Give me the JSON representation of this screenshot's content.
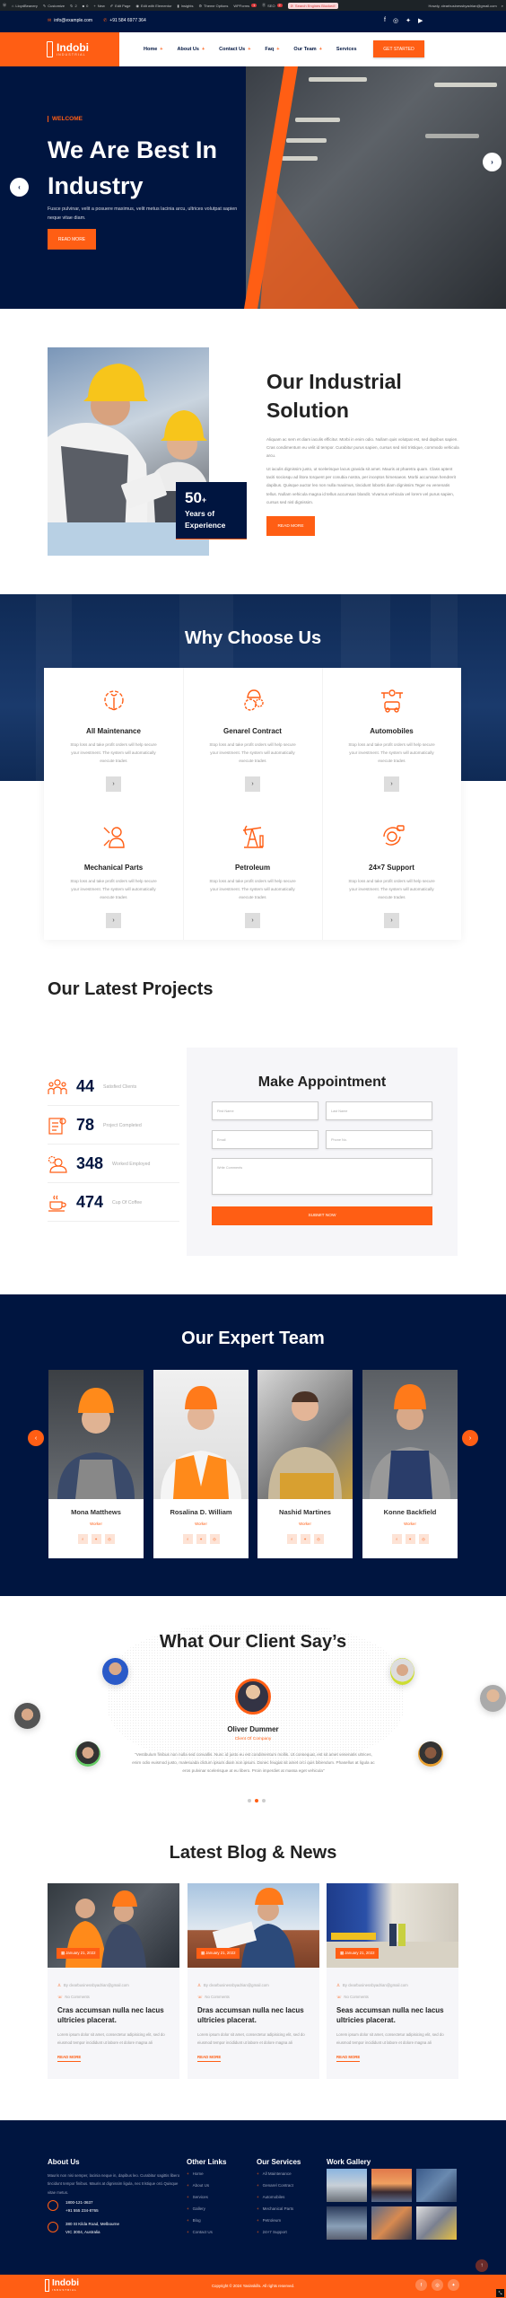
{
  "admin_bar": {
    "site": "LloydBeanery",
    "customize": "Customize",
    "updates": "2",
    "comments": "0",
    "new": "New",
    "edit_page": "Edit Page",
    "elementor": "Edit with Elementor",
    "insights": "Insights",
    "theme_options": "Theme Options",
    "wpforms": "WPForms",
    "wpforms_badge": "1",
    "seo": "SEO",
    "seo_badge": "2",
    "search_blocked": "Search Engines Blocked!",
    "howdy": "Howdy, clearbusinessbyadrian@gmail.com"
  },
  "topbar": {
    "email": "info@example.com",
    "phone": "+91 584 6977 364",
    "social_icons": [
      "facebook-icon",
      "instagram-icon",
      "twitter-icon",
      "youtube-icon"
    ]
  },
  "header": {
    "logo_name": "Indobi",
    "logo_sub": "INDUSTRIAL",
    "nav": [
      {
        "label": "Home",
        "has_sub": true
      },
      {
        "label": "About Us",
        "has_sub": true
      },
      {
        "label": "Contact Us",
        "has_sub": true
      },
      {
        "label": "Faq",
        "has_sub": true
      },
      {
        "label": "Our Team",
        "has_sub": true
      },
      {
        "label": "Services",
        "has_sub": false
      }
    ],
    "cta": "GET STARTED"
  },
  "hero": {
    "eyebrow": "WELCOME",
    "title": "We Are Best In Industry",
    "description": "Fusce pulvinar, velit a posuere maximus, velit metus lacinia arcu, ultrices volutpat sapien neque vitae diam.",
    "button": "READ MORE"
  },
  "solution": {
    "experience_number": "50",
    "experience_plus": "+",
    "experience_label": "Years of Experience",
    "title": "Our Industrial Solution",
    "paragraph1": "Aliquam ac sem et diam iaculis efficitur. Morbi in enim odio. Nullam quis volutpat est, sed dapibus sapien. Cras condimentum eu velit id tempor. Curabitur purus sapien, cursus sed nisl tristique, commodo vehicula arcu.",
    "paragraph2": "Ut iaculis dignissim justo, ut scelerisque lacus gravida sit amet. Mauris at pharetra quam. Class aptent taciti sociosqu ad litora torquent per conubia nostra, per inceptos himenaeos. Morbi accumsan hendrerit dapibus. Quisque auctor leo non nulla maximus, tincidunt lobortis diam dignissim.Teger eu venenatis tellus. Nullam vehicula magna id tellus accumsan blandit. Vivamus vehicula vel lorem vel purus sapien, cursus sed nisl dignissim.",
    "button": "READ MORE"
  },
  "why": {
    "title": "Why Choose Us",
    "features": [
      {
        "title": "All Maintenance",
        "icon": "gear-wrench-icon",
        "desc": "Stop loss and take profit orders will help secure your investment. The system will automatically execute trades"
      },
      {
        "title": "Genarel Contract",
        "icon": "helmet-gears-icon",
        "desc": "Stop loss and take profit orders will help secure your investment. The system will automatically execute trades"
      },
      {
        "title": "Automobiles",
        "icon": "car-circuit-icon",
        "desc": "Stop loss and take profit orders will help secure your investment. The system will automatically execute trades"
      },
      {
        "title": "Mechanical Parts",
        "icon": "mechanic-icon",
        "desc": "Stop loss and take profit orders will help secure your investment. The system will automatically execute trades"
      },
      {
        "title": "Petroleum",
        "icon": "oil-pump-icon",
        "desc": "Stop loss and take profit orders will help secure your investment. The system will automatically execute trades"
      },
      {
        "title": "24×7 Support",
        "icon": "support-agent-icon",
        "desc": "Stop loss and take profit orders will help secure your investment. The system will automatically execute trades"
      }
    ]
  },
  "projects": {
    "title": "Our Latest Projects",
    "stats": [
      {
        "value": "44",
        "label": "Satisfied Clients",
        "icon": "group-icon"
      },
      {
        "value": "78",
        "label": "Project Completed",
        "icon": "clipboard-check-icon"
      },
      {
        "value": "348",
        "label": "Worked Employed",
        "icon": "worker-icon"
      },
      {
        "value": "474",
        "label": "Cup Of Coffee",
        "icon": "coffee-cup-icon"
      }
    ]
  },
  "appointment": {
    "title": "Make Appointment",
    "first_name_placeholder": "First Name",
    "last_name_placeholder": "Last Name",
    "email_placeholder": "Email",
    "phone_placeholder": "Phone No.",
    "comments_placeholder": "Write Comments",
    "submit": "SUBMIT NOW"
  },
  "team": {
    "title": "Our Expert Team",
    "members": [
      {
        "name": "Mona Matthews",
        "role": "Worker"
      },
      {
        "name": "Rosalina D. William",
        "role": "Worker"
      },
      {
        "name": "Nashid Martines",
        "role": "Worker"
      },
      {
        "name": "Konne Backfield",
        "role": "Worker"
      }
    ]
  },
  "testimonials": {
    "title": "What Our Client Say’s",
    "name": "Oliver Dummer",
    "role": "Client Of Company",
    "quote": "\"Vestibulum finibus non nulla sed convallis. Nunc id justo eu est condimentum mollis. Ut consequat, est sit amet venenatis ultrices, enim odio euismod justo, malesuada dictum ipsum diam non ipsum. Donec feugiat sit amet orci quis bibendum. Phasellus at ligula ac eros pulvinar scelerisque at eu libero. Proin imperdiet at massa eget vehicula\"",
    "active_slide": 2,
    "slide_count": 3
  },
  "blog": {
    "title": "Latest Blog & News",
    "posts": [
      {
        "date": "January 21, 2022",
        "author": "By clearbusinessbyadrian@gmail.com",
        "comments": "No Comments",
        "title": "Cras accumsan nulla nec lacus ultricies placerat.",
        "excerpt": "Lorem ipsum dolor sit amet, consectetur adipisicing elit, sed do eiusmod tempor incididunt ut labore et dolore magna ali",
        "link": "READ MORE"
      },
      {
        "date": "January 21, 2022",
        "author": "By clearbusinessbyadrian@gmail.com",
        "comments": "No Comments",
        "title": "Dras accumsan nulla nec lacus ultricies placerat.",
        "excerpt": "Lorem ipsum dolor sit amet, consectetur adipisicing elit, sed do eiusmod tempor incididunt ut labore et dolore magna ali",
        "link": "READ MORE"
      },
      {
        "date": "January 21, 2022",
        "author": "By clearbusinessbyadrian@gmail.com",
        "comments": "No Comments",
        "title": "Seas accumsan nulla nec lacus ultricies placerat.",
        "excerpt": "Lorem ipsum dolor sit amet, consectetur adipisicing elit, sed do eiusmod tempor incididunt ut labore et dolore magna ali",
        "link": "READ MORE"
      }
    ]
  },
  "footer": {
    "about_title": "About Us",
    "about_text": "Mauris non nisi semper, lacinia neque in, dapibus leo. Curabitur sagittis libero tincidunt tempor finibus. Mauris at dignissim ligula, nec tristique orci.Quisque vitae metus.",
    "phone1": "1800-121-3637",
    "phone2": "+91 555 234-8765",
    "address1": "380 St Kilda Road, Melbourne",
    "address2": "VIC 3004, Australia",
    "links_title": "Other Links",
    "links": [
      "Home",
      "About Us",
      "Services",
      "Gallery",
      "Blog",
      "Contact Us"
    ],
    "services_title": "Our Services",
    "services": [
      "All Maintenance",
      "Genarel Contract",
      "Automobiles",
      "Mechanical Parts",
      "Petroleum",
      "24×7 Support"
    ],
    "gallery_title": "Work Gallery",
    "copyright": "Copyright © 2024 Yasinskills. All rights reserved."
  },
  "colors": {
    "accent": "#ff5e14",
    "navy": "#001540"
  }
}
